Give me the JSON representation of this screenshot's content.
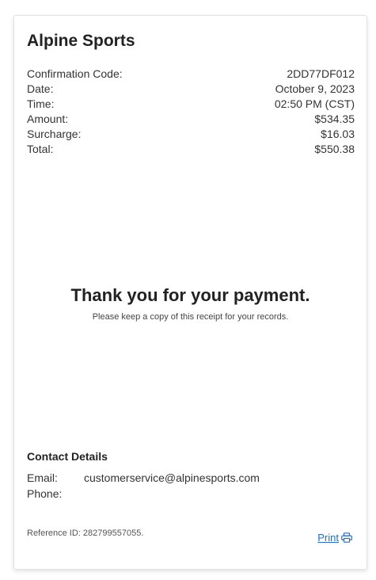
{
  "receipt": {
    "merchant_name": "Alpine Sports",
    "fields": [
      {
        "label": "Confirmation Code:",
        "value": "2DD77DF012"
      },
      {
        "label": "Date:",
        "value": "October 9, 2023"
      },
      {
        "label": "Time:",
        "value": "02:50 PM (CST)"
      },
      {
        "label": "Amount:",
        "value": "$534.35"
      },
      {
        "label": "Surcharge:",
        "value": "$16.03"
      },
      {
        "label": "Total:",
        "value": "$550.38"
      }
    ],
    "thank_you_title": "Thank you for your payment.",
    "thank_you_subtitle": "Please keep a copy of this receipt for your records.",
    "contact": {
      "title": "Contact Details",
      "email_label": "Email:",
      "email_value": "customerservice@alpinesports.com",
      "phone_label": "Phone:",
      "phone_value": ""
    },
    "reference_text": "Reference ID: 282799557055.",
    "print_label": "Print",
    "print_icon": "printer-icon",
    "link_color": "#2b6cc4"
  }
}
